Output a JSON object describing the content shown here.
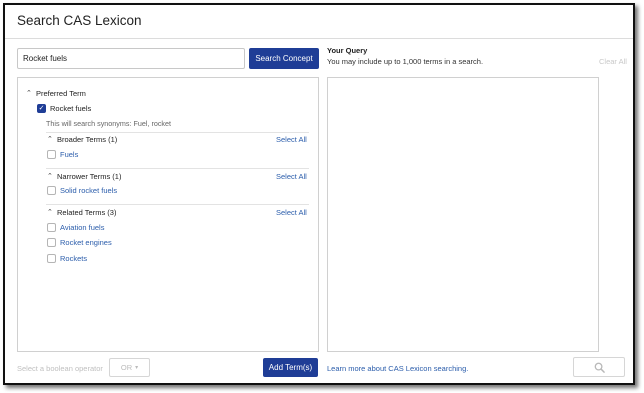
{
  "header": {
    "title": "Search CAS Lexicon"
  },
  "search": {
    "value": "Rocket fuels",
    "button_label": "Search Concept"
  },
  "query": {
    "title": "Your Query",
    "hint": "You may include up to 1,000 terms in a search.",
    "clear_all_label": "Clear All"
  },
  "preferred": {
    "section_label": "Preferred Term",
    "term": "Rocket fuels",
    "synonyms_text": "This will search synonyms: Fuel, rocket"
  },
  "groups": [
    {
      "label": "Broader Terms (1)",
      "select_all": "Select All",
      "terms": [
        "Fuels"
      ]
    },
    {
      "label": "Narrower Terms (1)",
      "select_all": "Select All",
      "terms": [
        "Solid rocket fuels"
      ]
    },
    {
      "label": "Related Terms (3)",
      "select_all": "Select All",
      "terms": [
        "Aviation fuels",
        "Rocket engines",
        "Rockets"
      ]
    }
  ],
  "footer": {
    "boolean_label": "Select a boolean operator",
    "boolean_value": "OR",
    "add_button_label": "Add Term(s)",
    "learn_more_label": "Learn more about CAS Lexicon searching."
  },
  "icons": {
    "expand": "caret-up-icon",
    "checked": "checkmark-icon",
    "dropdown": "caret-down-icon",
    "run_search": "magnifier-icon"
  },
  "colors": {
    "primary": "#1f3d96",
    "link": "#2b5dab",
    "disabled": "#c0c0c0",
    "border": "#d0d0d0"
  }
}
